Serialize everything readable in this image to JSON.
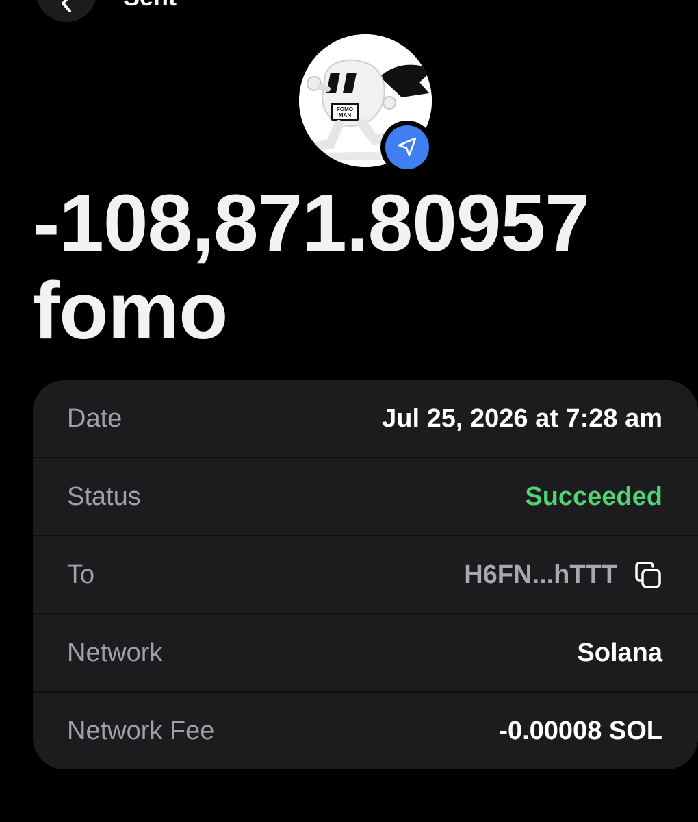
{
  "nav": {
    "title": "Sent",
    "back_icon": "chevron-left-icon"
  },
  "token": {
    "avatar_text": "FOMO MAN",
    "badge_icon": "send-arrow-icon",
    "badge_color": "#3f7ff2"
  },
  "amount": {
    "value": "-108,871.80957",
    "symbol": "fomo"
  },
  "details": {
    "date_label": "Date",
    "date_value": "Jul 25, 2026 at 7:28 am",
    "status_label": "Status",
    "status_value": "Succeeded",
    "status_color": "#52d273",
    "to_label": "To",
    "to_value": "H6FN...hTTT",
    "copy_icon": "copy-icon",
    "network_label": "Network",
    "network_value": "Solana",
    "fee_label": "Network Fee",
    "fee_value": "-0.00008 SOL"
  }
}
